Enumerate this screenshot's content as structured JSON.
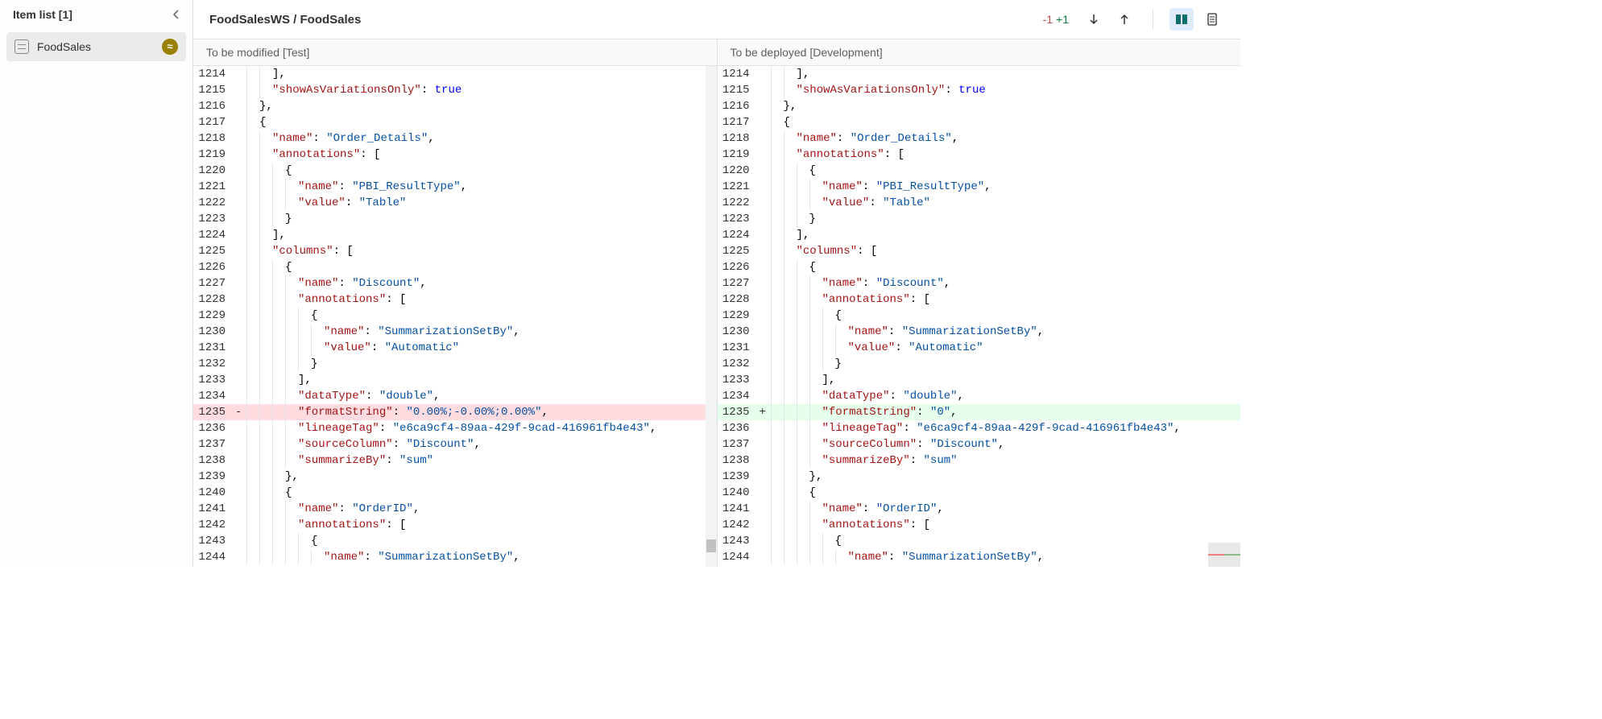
{
  "sidebar": {
    "title": "Item list [1]",
    "items": [
      {
        "label": "FoodSales"
      }
    ]
  },
  "header": {
    "breadcrumb": "FoodSalesWS / FoodSales",
    "minus": "-1",
    "plus": "+1"
  },
  "panes": {
    "left": {
      "title": "To be modified [Test]"
    },
    "right": {
      "title": "To be deployed [Development]"
    }
  },
  "code": {
    "startLine": 1214,
    "diffLine": 1235,
    "lines": [
      {
        "indent": 2,
        "tokens": [
          {
            "t": "punc",
            "v": "],"
          }
        ]
      },
      {
        "indent": 2,
        "tokens": [
          {
            "t": "key",
            "v": "\"showAsVariationsOnly\""
          },
          {
            "t": "punc",
            "v": ": "
          },
          {
            "t": "bool",
            "v": "true"
          }
        ]
      },
      {
        "indent": 1,
        "tokens": [
          {
            "t": "punc",
            "v": "},"
          }
        ]
      },
      {
        "indent": 1,
        "tokens": [
          {
            "t": "punc",
            "v": "{"
          }
        ]
      },
      {
        "indent": 2,
        "tokens": [
          {
            "t": "key",
            "v": "\"name\""
          },
          {
            "t": "punc",
            "v": ": "
          },
          {
            "t": "str",
            "v": "\"Order_Details\""
          },
          {
            "t": "punc",
            "v": ","
          }
        ]
      },
      {
        "indent": 2,
        "tokens": [
          {
            "t": "key",
            "v": "\"annotations\""
          },
          {
            "t": "punc",
            "v": ": ["
          }
        ]
      },
      {
        "indent": 3,
        "tokens": [
          {
            "t": "punc",
            "v": "{"
          }
        ]
      },
      {
        "indent": 4,
        "tokens": [
          {
            "t": "key",
            "v": "\"name\""
          },
          {
            "t": "punc",
            "v": ": "
          },
          {
            "t": "str",
            "v": "\"PBI_ResultType\""
          },
          {
            "t": "punc",
            "v": ","
          }
        ]
      },
      {
        "indent": 4,
        "tokens": [
          {
            "t": "key",
            "v": "\"value\""
          },
          {
            "t": "punc",
            "v": ": "
          },
          {
            "t": "str",
            "v": "\"Table\""
          }
        ]
      },
      {
        "indent": 3,
        "tokens": [
          {
            "t": "punc",
            "v": "}"
          }
        ]
      },
      {
        "indent": 2,
        "tokens": [
          {
            "t": "punc",
            "v": "],"
          }
        ]
      },
      {
        "indent": 2,
        "tokens": [
          {
            "t": "key",
            "v": "\"columns\""
          },
          {
            "t": "punc",
            "v": ": ["
          }
        ]
      },
      {
        "indent": 3,
        "tokens": [
          {
            "t": "punc",
            "v": "{"
          }
        ]
      },
      {
        "indent": 4,
        "tokens": [
          {
            "t": "key",
            "v": "\"name\""
          },
          {
            "t": "punc",
            "v": ": "
          },
          {
            "t": "str",
            "v": "\"Discount\""
          },
          {
            "t": "punc",
            "v": ","
          }
        ]
      },
      {
        "indent": 4,
        "tokens": [
          {
            "t": "key",
            "v": "\"annotations\""
          },
          {
            "t": "punc",
            "v": ": ["
          }
        ]
      },
      {
        "indent": 5,
        "tokens": [
          {
            "t": "punc",
            "v": "{"
          }
        ]
      },
      {
        "indent": 6,
        "tokens": [
          {
            "t": "key",
            "v": "\"name\""
          },
          {
            "t": "punc",
            "v": ": "
          },
          {
            "t": "str",
            "v": "\"SummarizationSetBy\""
          },
          {
            "t": "punc",
            "v": ","
          }
        ]
      },
      {
        "indent": 6,
        "tokens": [
          {
            "t": "key",
            "v": "\"value\""
          },
          {
            "t": "punc",
            "v": ": "
          },
          {
            "t": "str",
            "v": "\"Automatic\""
          }
        ]
      },
      {
        "indent": 5,
        "tokens": [
          {
            "t": "punc",
            "v": "}"
          }
        ]
      },
      {
        "indent": 4,
        "tokens": [
          {
            "t": "punc",
            "v": "],"
          }
        ]
      },
      {
        "indent": 4,
        "tokens": [
          {
            "t": "key",
            "v": "\"dataType\""
          },
          {
            "t": "punc",
            "v": ": "
          },
          {
            "t": "str",
            "v": "\"double\""
          },
          {
            "t": "punc",
            "v": ","
          }
        ]
      },
      {
        "indent": 4,
        "diff": true,
        "left": [
          {
            "t": "key",
            "v": "\"formatString\""
          },
          {
            "t": "punc",
            "v": ": "
          },
          {
            "t": "str",
            "v": "\"0.00%;-0.00%;0.00%\""
          },
          {
            "t": "punc",
            "v": ","
          }
        ],
        "right": [
          {
            "t": "key",
            "v": "\"formatString\""
          },
          {
            "t": "punc",
            "v": ": "
          },
          {
            "t": "str",
            "v": "\"0\""
          },
          {
            "t": "punc",
            "v": ","
          }
        ]
      },
      {
        "indent": 4,
        "tokens": [
          {
            "t": "key",
            "v": "\"lineageTag\""
          },
          {
            "t": "punc",
            "v": ": "
          },
          {
            "t": "str",
            "v": "\"e6ca9cf4-89aa-429f-9cad-416961fb4e43\""
          },
          {
            "t": "punc",
            "v": ","
          }
        ]
      },
      {
        "indent": 4,
        "tokens": [
          {
            "t": "key",
            "v": "\"sourceColumn\""
          },
          {
            "t": "punc",
            "v": ": "
          },
          {
            "t": "str",
            "v": "\"Discount\""
          },
          {
            "t": "punc",
            "v": ","
          }
        ]
      },
      {
        "indent": 4,
        "tokens": [
          {
            "t": "key",
            "v": "\"summarizeBy\""
          },
          {
            "t": "punc",
            "v": ": "
          },
          {
            "t": "str",
            "v": "\"sum\""
          }
        ]
      },
      {
        "indent": 3,
        "tokens": [
          {
            "t": "punc",
            "v": "},"
          }
        ]
      },
      {
        "indent": 3,
        "tokens": [
          {
            "t": "punc",
            "v": "{"
          }
        ]
      },
      {
        "indent": 4,
        "tokens": [
          {
            "t": "key",
            "v": "\"name\""
          },
          {
            "t": "punc",
            "v": ": "
          },
          {
            "t": "str",
            "v": "\"OrderID\""
          },
          {
            "t": "punc",
            "v": ","
          }
        ]
      },
      {
        "indent": 4,
        "tokens": [
          {
            "t": "key",
            "v": "\"annotations\""
          },
          {
            "t": "punc",
            "v": ": ["
          }
        ]
      },
      {
        "indent": 5,
        "tokens": [
          {
            "t": "punc",
            "v": "{"
          }
        ]
      },
      {
        "indent": 6,
        "tokens": [
          {
            "t": "key",
            "v": "\"name\""
          },
          {
            "t": "punc",
            "v": ": "
          },
          {
            "t": "str",
            "v": "\"SummarizationSetBy\""
          },
          {
            "t": "punc",
            "v": ","
          }
        ]
      }
    ]
  }
}
